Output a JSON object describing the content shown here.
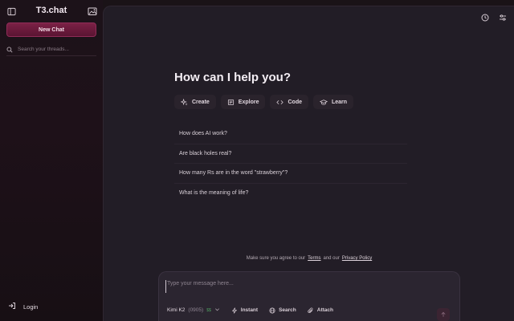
{
  "sidebar": {
    "title": "T3.chat",
    "new_chat_label": "New Chat",
    "search_placeholder": "Search your threads...",
    "login_label": "Login"
  },
  "main": {
    "heading": "How can I help you?",
    "chips": [
      {
        "label": "Create",
        "icon": "sparkles-icon"
      },
      {
        "label": "Explore",
        "icon": "newspaper-icon"
      },
      {
        "label": "Code",
        "icon": "code-icon"
      },
      {
        "label": "Learn",
        "icon": "graduation-cap-icon"
      }
    ],
    "suggestions": [
      "How does AI work?",
      "Are black holes real?",
      "How many Rs are in the word \"strawberry\"?",
      "What is the meaning of life?"
    ],
    "agree": {
      "prefix": "Make sure you agree to our",
      "terms": "Terms",
      "middle": "and our",
      "privacy": "Privacy Policy"
    }
  },
  "composer": {
    "placeholder": "Type your message here...",
    "model_name": "Kimi K2",
    "model_version": "(0905)",
    "model_badge": "$$",
    "instant_label": "Instant",
    "search_label": "Search",
    "attach_label": "Attach"
  },
  "colors": {
    "accent": "#7b2146",
    "background": "#221d26",
    "sidebar": "#1c1219"
  }
}
